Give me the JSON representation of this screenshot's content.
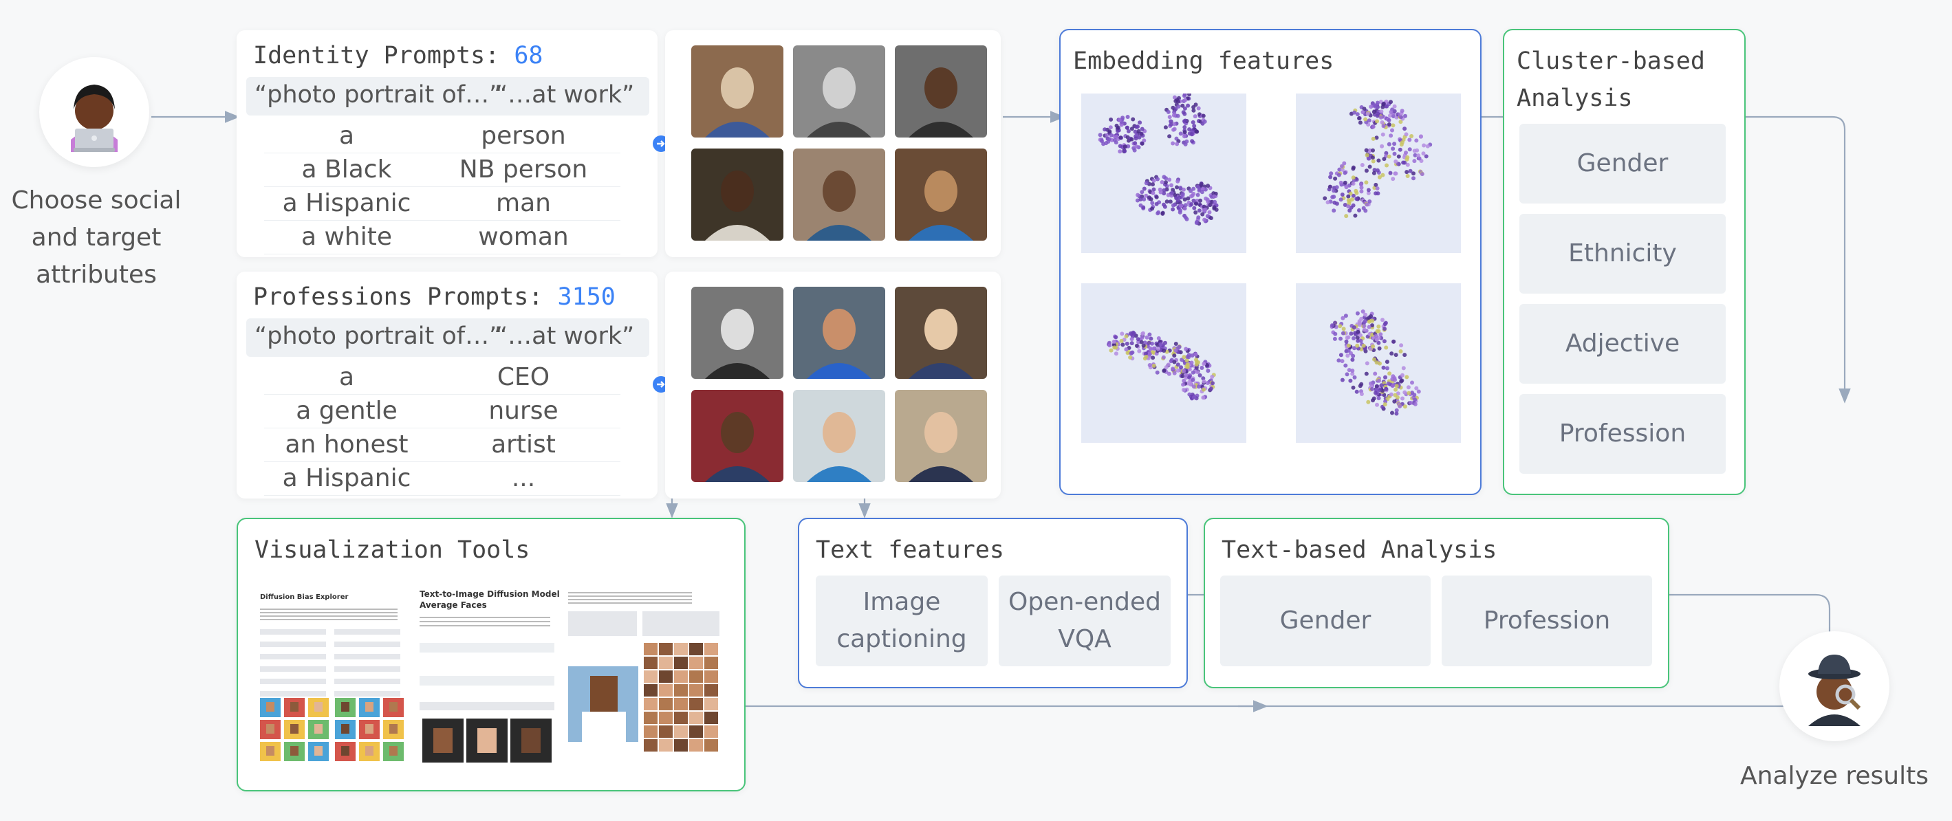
{
  "start": {
    "caption": "Choose social and target attributes",
    "icon": "person-with-laptop-icon"
  },
  "identity": {
    "title": "Identity Prompts:",
    "count": "68",
    "quote_left": "“photo portrait of…”",
    "quote_right": "“…at work”",
    "col1": [
      "a",
      "a Black",
      "a Hispanic",
      "a white"
    ],
    "col2": [
      "person",
      "NB person",
      "man",
      "woman"
    ]
  },
  "professions": {
    "title": "Professions Prompts:",
    "count": "3150",
    "quote_left": "“photo portrait of…”",
    "quote_right": "“…at work”",
    "col1": [
      "a",
      "a gentle",
      "an honest",
      "a Hispanic"
    ],
    "col2": [
      "CEO",
      "nurse",
      "artist",
      "..."
    ]
  },
  "identity_images": {
    "icon": "generated-portrait-image-icon",
    "count": 6
  },
  "profession_images": {
    "icon": "generated-portrait-image-icon",
    "count": 6
  },
  "embedding": {
    "title": "Embedding features",
    "plot_icon": "scatter-plot-icon"
  },
  "cluster": {
    "title_line1": "Cluster-based",
    "title_line2": "Analysis",
    "items": [
      "Gender",
      "Ethnicity",
      "Adjective",
      "Profession"
    ]
  },
  "visualization": {
    "title": "Visualization Tools",
    "shot1_title": "Diffusion Bias Explorer",
    "shot2_title_line1": "Text-to-Image Diffusion Model",
    "shot2_title_line2": "Average Faces"
  },
  "text_features": {
    "title": "Text features",
    "item1_line1": "Image",
    "item1_line2": "captioning",
    "item2_line1": "Open-ended",
    "item2_line2": "VQA"
  },
  "text_analysis": {
    "title": "Text-based Analysis",
    "items": [
      "Gender",
      "Profession"
    ]
  },
  "end": {
    "caption": "Analyze results",
    "icon": "detective-icon"
  },
  "colors": {
    "blue": "#4d7bd8",
    "green": "#49c47a",
    "accent": "#3b82f6",
    "wire": "#9aa9bd"
  }
}
